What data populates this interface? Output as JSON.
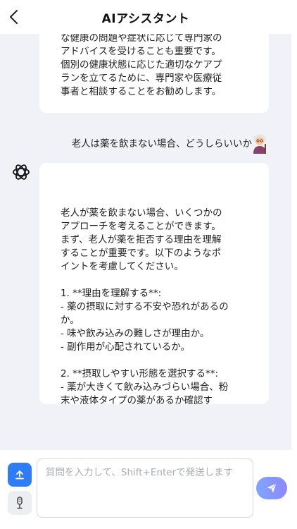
{
  "header": {
    "title": "AIアシスタント"
  },
  "messages": {
    "previous_ai_tail": "な健康の問題や症状に応じて専門家の\nアドバイスを受けることも重要です。\n個別の健康状態に応じた適切なケアプ\nランを立てるために、専門家や医療従\n事者と相談することをお勧めします。",
    "user_question": "老人は薬を飲まない場合、どうしらいいか",
    "ai_answer": "老人が薬を飲まない場合、いくつかの\nアプローチを考えることができます。\nまず、老人が薬を拒否する理由を理解\nすることが重要です。以下のようなポ\nイントを考慮してください。\n\n1. **理由を理解する**:\n- 薬の摂取に対する不安や恐れがあるの\nか。\n- 味や飲み込みの難しさが理由か。\n- 副作用が心配されているか。\n\n2. **摂取しやすい形態を選択する**:\n- 薬が大きくて飲み込みづらい場合、粉\n末や液体タイプの薬があるか確認す\nる。\n- 可能であれば、薬の形態を変更する。"
  },
  "input": {
    "placeholder": "質問を入力して、Shift+Enterで発送します",
    "value": ""
  },
  "icons": {
    "back": "chevron-left-icon",
    "ai_avatar": "openai-logo-icon",
    "user_avatar": "elderly-person-avatar",
    "upload": "upload-icon",
    "mic": "microphone-icon",
    "send": "paper-plane-icon"
  },
  "colors": {
    "accent_blue": "#2f7df6",
    "send_gradient_start": "#7ea6ff",
    "send_gradient_end": "#8f87ff",
    "chat_background": "#f1f2f8"
  }
}
